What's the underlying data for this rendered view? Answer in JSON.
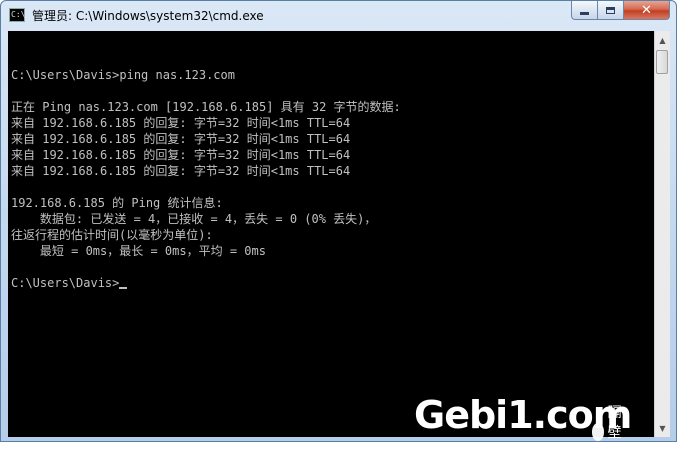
{
  "window": {
    "title": "管理员: C:\\Windows\\system32\\cmd.exe",
    "icon": "cmd-icon",
    "icon_text": "C:\\",
    "controls": {
      "minimize": "minimize-icon",
      "maximize": "maximize-icon",
      "close_label": "✕"
    }
  },
  "console": {
    "background": "#000000",
    "foreground": "#c0c0c0",
    "lines": [
      "",
      "C:\\Users\\Davis>ping nas.123.com",
      "",
      "正在 Ping nas.123.com [192.168.6.185] 具有 32 字节的数据:",
      "来自 192.168.6.185 的回复: 字节=32 时间<1ms TTL=64",
      "来自 192.168.6.185 的回复: 字节=32 时间<1ms TTL=64",
      "来自 192.168.6.185 的回复: 字节=32 时间<1ms TTL=64",
      "来自 192.168.6.185 的回复: 字节=32 时间<1ms TTL=64",
      "",
      "192.168.6.185 的 Ping 统计信息:",
      "    数据包: 已发送 = 4，已接收 = 4，丢失 = 0 (0% 丢失)，",
      "往返行程的估计时间(以毫秒为单位):",
      "    最短 = 0ms，最长 = 0ms，平均 = 0ms",
      "",
      "C:\\Users\\Davis>"
    ]
  },
  "scrollbar": {
    "up_arrow": "▲",
    "down_arrow": "▼"
  },
  "watermark": {
    "text": "Gebi1.com",
    "badge_text": "隔壁网"
  }
}
